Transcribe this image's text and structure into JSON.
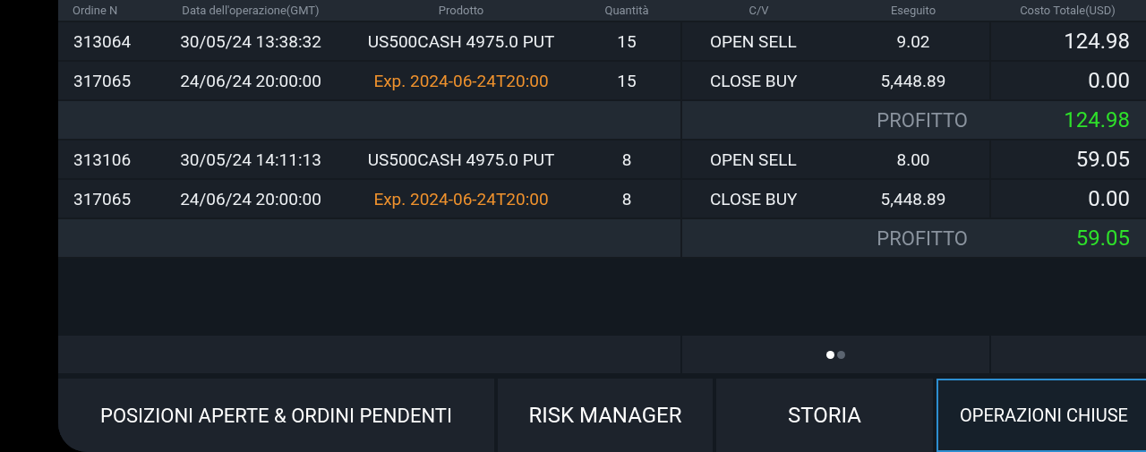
{
  "table": {
    "columns": [
      "Ordine N",
      "Data dell'operazione(GMT)",
      "Prodotto",
      "Quantità",
      "C/V",
      "Eseguito",
      "Costo Totale(USD)"
    ],
    "groups": [
      {
        "rows": [
          {
            "kind": "open",
            "order": "313064",
            "date": "30/05/24 13:38:32",
            "product": "US500CASH 4975.0 PUT",
            "qty": "15",
            "side": "OPEN SELL",
            "executed": "9.02",
            "total": "124.98"
          },
          {
            "kind": "expiry",
            "order": "317065",
            "date": "24/06/24 20:00:00",
            "product": "Exp. 2024-06-24T20:00",
            "qty": "15",
            "side": "CLOSE BUY",
            "executed": "5,448.89",
            "total": "0.00"
          }
        ],
        "profit_label": "PROFITTO",
        "profit": "124.98"
      },
      {
        "rows": [
          {
            "kind": "open",
            "order": "313106",
            "date": "30/05/24 14:11:13",
            "product": "US500CASH 4975.0 PUT",
            "qty": "8",
            "side": "OPEN SELL",
            "executed": "8.00",
            "total": "59.05"
          },
          {
            "kind": "expiry",
            "order": "317065",
            "date": "24/06/24 20:00:00",
            "product": "Exp. 2024-06-24T20:00",
            "qty": "8",
            "side": "CLOSE BUY",
            "executed": "5,448.89",
            "total": "0.00"
          }
        ],
        "profit_label": "PROFITTO",
        "profit": "59.05"
      }
    ]
  },
  "pages": [
    {
      "selected": true
    },
    {
      "selected": false
    }
  ],
  "tabs": [
    {
      "label": "POSIZIONI APERTE & ORDINI PENDENTI",
      "selected": false
    },
    {
      "label": "RISK MANAGER",
      "selected": false
    },
    {
      "label": "STORIA",
      "selected": false
    },
    {
      "label": "OPERAZIONI CHIUSE",
      "selected": true
    }
  ]
}
